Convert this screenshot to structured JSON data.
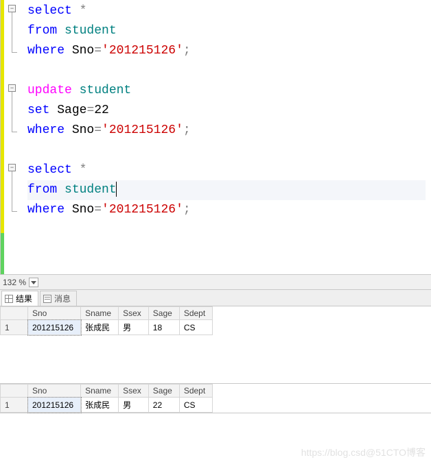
{
  "editor": {
    "zoom": "132 %",
    "lines": {
      "l1": {
        "kw": "select",
        "star": "*"
      },
      "l2": {
        "kw": "from",
        "tbl": "student"
      },
      "l3": {
        "kw": "where",
        "col": "Sno",
        "op": "=",
        "str": "'201215126'",
        "semi": ";"
      },
      "l4": "",
      "l5": {
        "kw": "update",
        "tbl": "student"
      },
      "l6": {
        "kw": "set",
        "col": "Sage",
        "op": "=",
        "val": "22"
      },
      "l7": {
        "kw": "where",
        "col": "Sno",
        "op": "=",
        "str": "'201215126'",
        "semi": ";"
      },
      "l8": "",
      "l9": {
        "kw": "select",
        "star": "*"
      },
      "l10": {
        "kw": "from",
        "tbl": "student"
      },
      "l11": {
        "kw": "where",
        "col": "Sno",
        "op": "=",
        "str": "'201215126'",
        "semi": ";"
      }
    }
  },
  "tabs": {
    "results": "结果",
    "messages": "消息"
  },
  "grid": {
    "headers": {
      "c1": "Sno",
      "c2": "Sname",
      "c3": "Ssex",
      "c4": "Sage",
      "c5": "Sdept"
    },
    "r1": {
      "idx": "1",
      "c1": "201215126",
      "c2": "张成民",
      "c3": "男",
      "c4": "18",
      "c5": "CS"
    },
    "r2": {
      "idx": "1",
      "c1": "201215126",
      "c2": "张成民",
      "c3": "男",
      "c4": "22",
      "c5": "CS"
    }
  },
  "watermark": "https://blog.csd@51CTO博客"
}
